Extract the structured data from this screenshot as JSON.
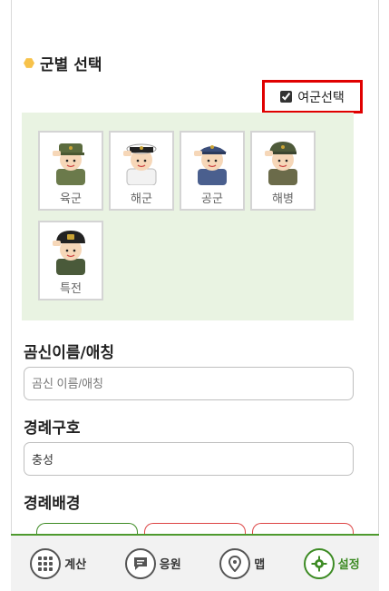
{
  "branch_section": {
    "title": "군별 선택",
    "female_option": {
      "label": "여군선택",
      "checked": true
    },
    "branches": [
      {
        "label": "육군",
        "icon": "army-soldier-avatar",
        "hat_color": "#5b6b3e"
      },
      {
        "label": "해군",
        "icon": "navy-sailor-avatar",
        "hat_color": "#ffffff"
      },
      {
        "label": "공군",
        "icon": "airforce-pilot-avatar",
        "hat_color": "#3b4e7a"
      },
      {
        "label": "해병",
        "icon": "marine-avatar",
        "hat_color": "#4e5a3a"
      },
      {
        "label": "특전",
        "icon": "special-forces-avatar",
        "hat_color": "#222222"
      }
    ]
  },
  "form": {
    "nickname_label": "곰신이름/애칭",
    "nickname_placeholder": "곰신 이름/애칭",
    "salute_label": "경례구호",
    "salute_value": "충성",
    "background_label": "경례배경"
  },
  "tabs": [
    {
      "label": "계산",
      "icon": "grid-icon",
      "active": false
    },
    {
      "label": "응원",
      "icon": "chat-icon",
      "active": false
    },
    {
      "label": "맵",
      "icon": "map-pin-icon",
      "active": false
    },
    {
      "label": "설정",
      "icon": "gear-icon",
      "active": true
    }
  ],
  "colors": {
    "accent": "#3d8b24",
    "highlight_border": "#e00000",
    "panel_bg": "#e9f3e2"
  }
}
